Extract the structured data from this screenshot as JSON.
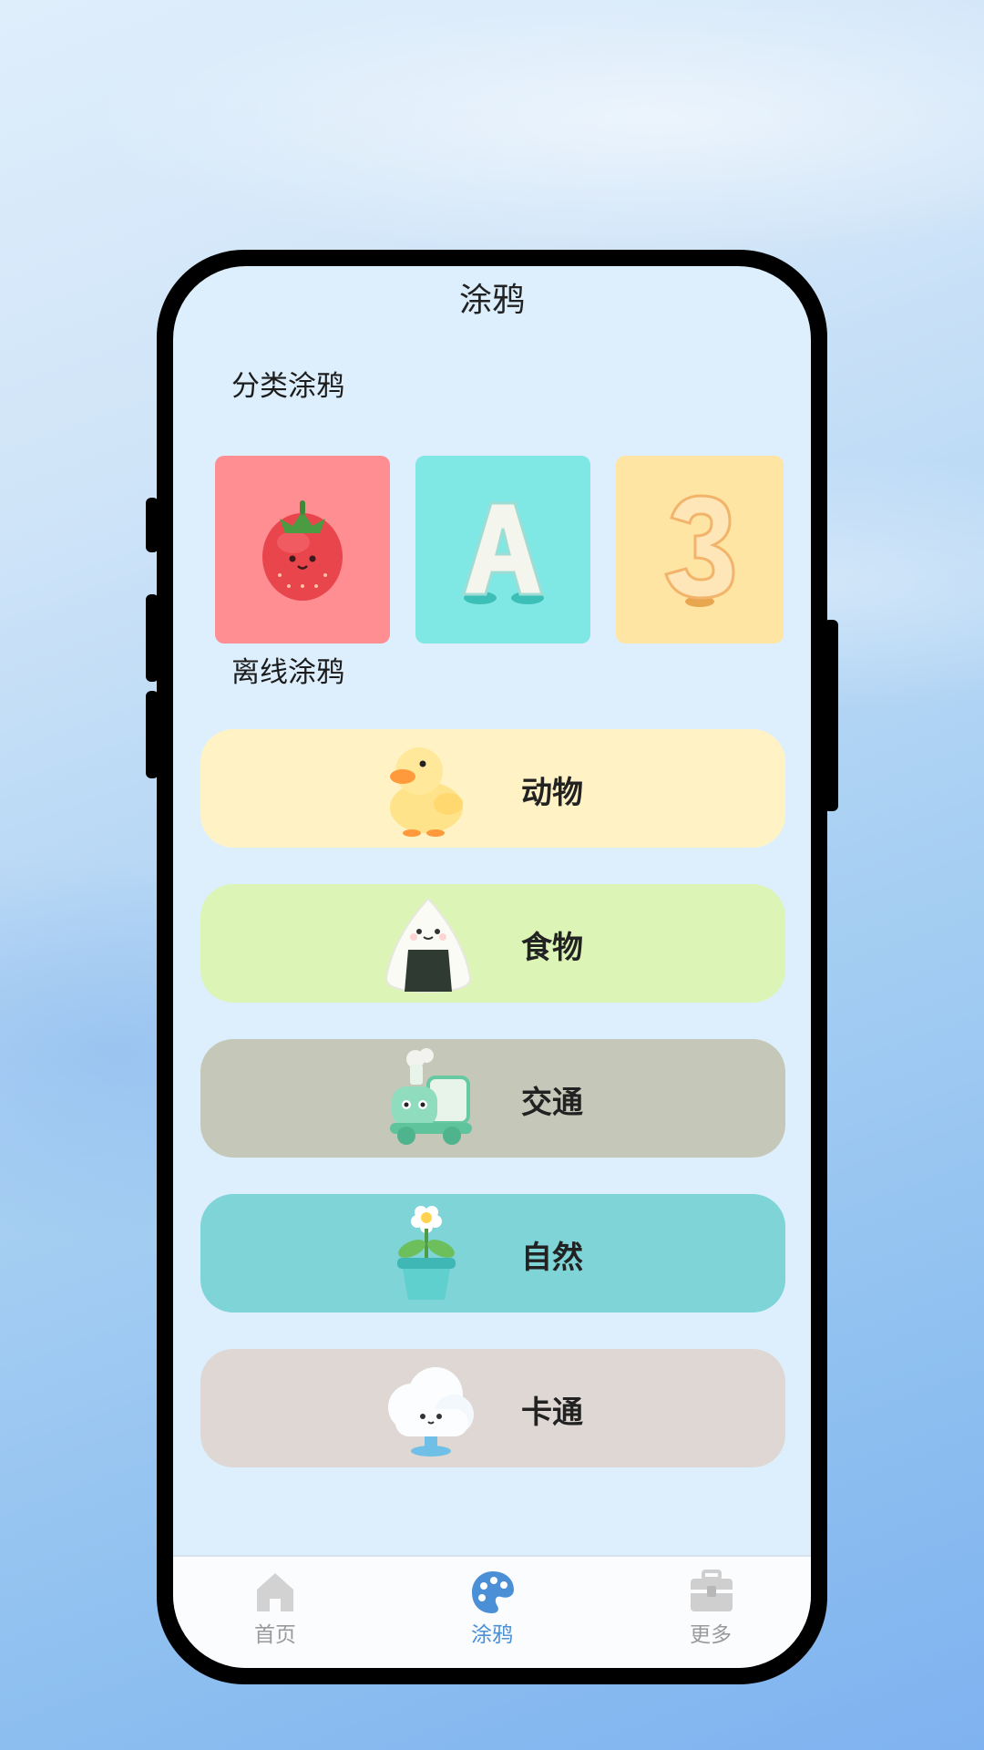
{
  "app": {
    "title": "涂鸦"
  },
  "category_section": {
    "title": "分类涂鸦",
    "tiles": [
      {
        "name": "strawberry",
        "color": "#ff8e93"
      },
      {
        "name": "letter",
        "glyph": "A",
        "color": "#7fe8e4"
      },
      {
        "name": "number",
        "glyph": "3",
        "color": "#fee5a4"
      }
    ]
  },
  "offline_section": {
    "title": "离线涂鸦",
    "items": [
      {
        "label": "动物",
        "icon": "duck-icon",
        "color": "#fff3c6"
      },
      {
        "label": "食物",
        "icon": "rice-ball-icon",
        "color": "#dcf5b7"
      },
      {
        "label": "交通",
        "icon": "train-icon",
        "color": "#c5c8b8"
      },
      {
        "label": "自然",
        "icon": "flower-pot-icon",
        "color": "#7ed4d6"
      },
      {
        "label": "卡通",
        "icon": "cloud-icon",
        "color": "#dfd7d3"
      }
    ]
  },
  "tabbar": {
    "items": [
      {
        "label": "首页",
        "icon": "home-icon",
        "active": false
      },
      {
        "label": "涂鸦",
        "icon": "palette-icon",
        "active": true
      },
      {
        "label": "更多",
        "icon": "toolbox-icon",
        "active": false
      }
    ]
  }
}
